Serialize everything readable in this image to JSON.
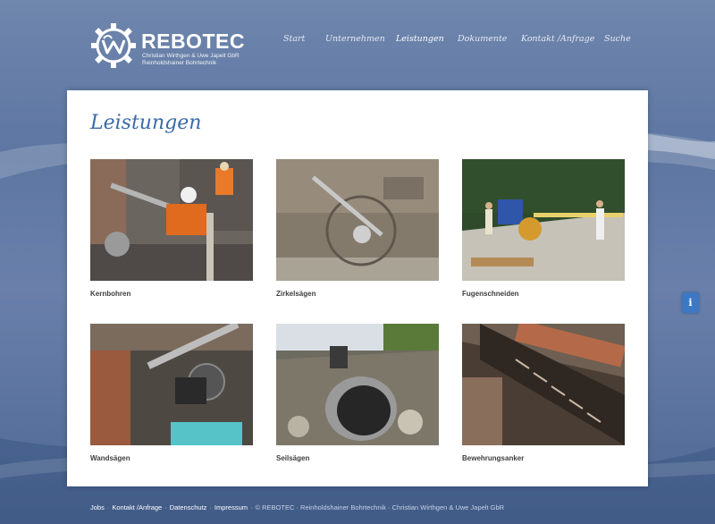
{
  "brand": {
    "name": "REBOTEC",
    "sub1": "Christian Wirthgen & Uwe Japelt GbR",
    "sub2": "Reinholdshainer Bohrtechnik"
  },
  "nav": {
    "items": [
      {
        "label": "Start"
      },
      {
        "label": "Unternehmen"
      },
      {
        "label": "Leistungen"
      },
      {
        "label": "Dokumente"
      },
      {
        "label": "Kontakt /Anfrage"
      },
      {
        "label": "Suche"
      }
    ],
    "active": "Leistungen"
  },
  "page": {
    "title": "Leistungen"
  },
  "services": [
    {
      "caption": "Kernbohren"
    },
    {
      "caption": "Zirkelsägen"
    },
    {
      "caption": "Fugenschneiden"
    },
    {
      "caption": "Wandsägen"
    },
    {
      "caption": "Seilsägen"
    },
    {
      "caption": "Bewehrungsanker"
    }
  ],
  "info_button": {
    "label": "i"
  },
  "footer": {
    "links": [
      "Jobs",
      "Kontakt /Anfrage",
      "Datenschutz",
      "Impressum"
    ],
    "copyright": "© REBOTEC · Reinholdshainer Bohrtechnik · Christian Wirthgen & Uwe Japelt GbR"
  },
  "colors": {
    "accent": "#3a6aa8",
    "background": "#6a80ab",
    "info": "#3c78c3"
  }
}
